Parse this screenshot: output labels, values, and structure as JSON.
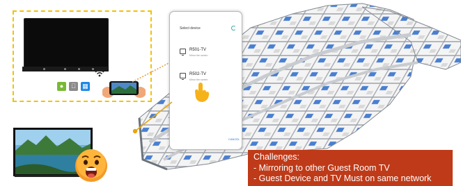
{
  "popup": {
    "title": "Select device",
    "devices": [
      {
        "name": "R501-TV",
        "subtitle": "Mirror the screen"
      },
      {
        "name": "R502-TV",
        "subtitle": "Mirror the screen"
      }
    ],
    "cancel_label": "CANCEL"
  },
  "challenges": {
    "heading": "Challenges:",
    "items": [
      "- Mirroring to other Guest Room TV",
      "- Guest Device and TV Must on same network"
    ]
  },
  "icons": {
    "os": [
      "android-icon",
      "apple-icon",
      "windows-icon"
    ],
    "wifi": "wifi-icon",
    "emoji": "shocked-face-icon"
  },
  "colors": {
    "frame": "#f2c200",
    "challenge_bg": "#bf3a18",
    "cancel": "#1e6fd9",
    "connector": "#e8a50c"
  }
}
